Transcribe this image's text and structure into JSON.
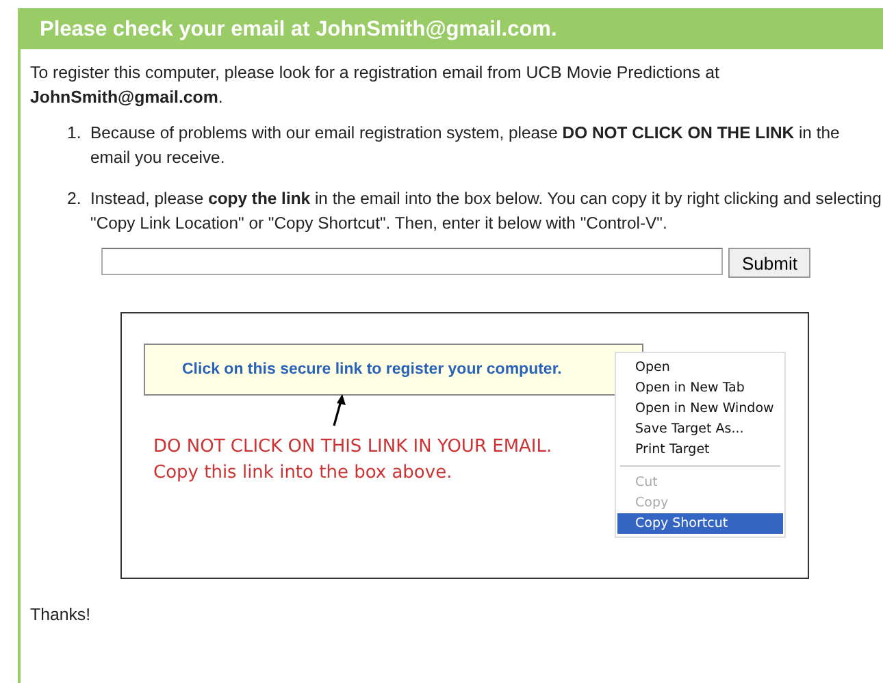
{
  "header": {
    "title": "Please check your email at JohnSmith@gmail.com."
  },
  "intro": "To register this computer, please look for a registration email from UCB Movie Predictions at **JohnSmith@gmail.com**.",
  "steps": [
    {
      "number": "1.",
      "text": "Because of problems with our email registration system, please **DO NOT CLICK ON THE LINK** in the email you receive."
    },
    {
      "number": "2.",
      "text": "Instead, please **copy the link** in the email into the box below. You can copy it by right clicking and selecting \"Copy Link Location\" or \"Copy Shortcut\". Then, enter it below with \"Control-V\"."
    }
  ],
  "form": {
    "submit": "Submit"
  },
  "example": {
    "link": "Click on this secure link to register your computer.",
    "warning": [
      "DO NOT CLICK ON THIS LINK IN YOUR EMAIL.",
      "Copy this link into the box above."
    ],
    "menu": [
      {
        "kind": "item",
        "label": "Open",
        "disabled": false,
        "selected": false
      },
      {
        "kind": "item",
        "label": "Open in New Tab",
        "disabled": false,
        "selected": false
      },
      {
        "kind": "item",
        "label": "Open in New Window",
        "disabled": false,
        "selected": false
      },
      {
        "kind": "item",
        "label": "Save Target As...",
        "disabled": false,
        "selected": false
      },
      {
        "kind": "item",
        "label": "Print Target",
        "disabled": false,
        "selected": false
      },
      {
        "kind": "separator"
      },
      {
        "kind": "item",
        "label": "Cut",
        "disabled": true,
        "selected": false
      },
      {
        "kind": "item",
        "label": "Copy",
        "disabled": true,
        "selected": false
      },
      {
        "kind": "item",
        "label": "Copy Shortcut",
        "disabled": false,
        "selected": true
      }
    ]
  },
  "footer": "Thanks!"
}
